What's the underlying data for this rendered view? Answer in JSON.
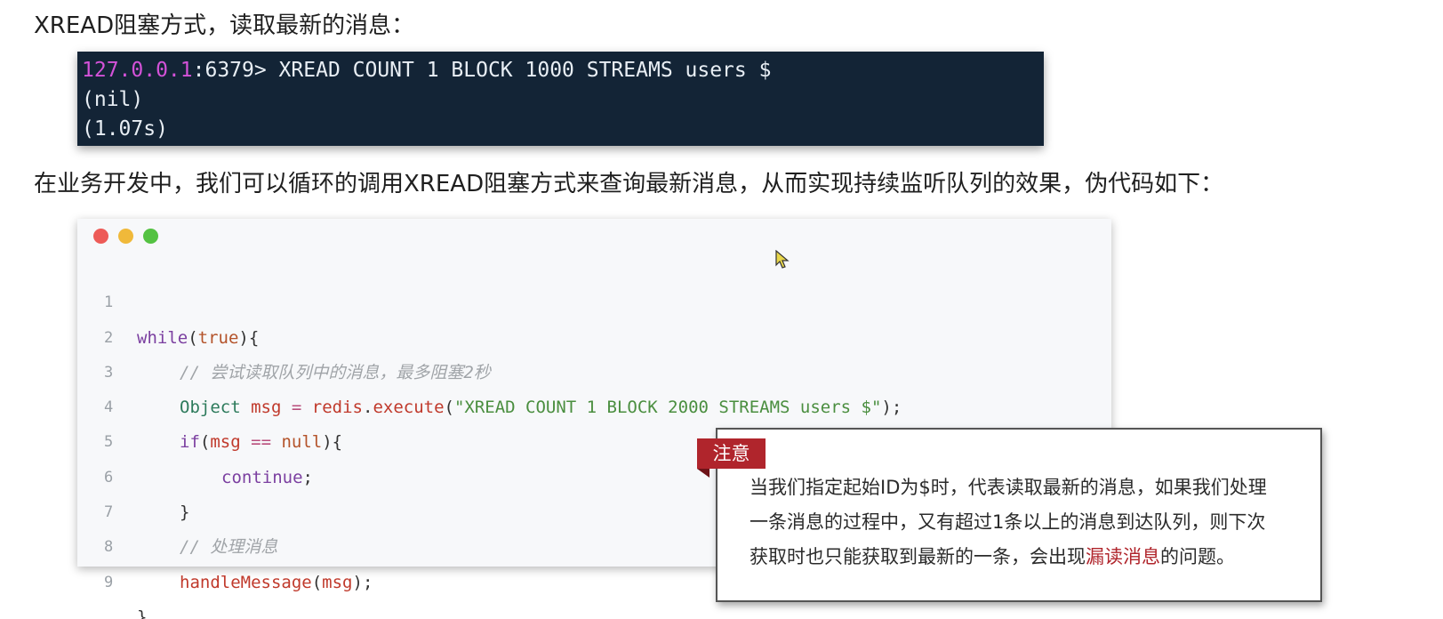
{
  "heading_1": "XREAD阻塞方式，读取最新的消息：",
  "terminal": {
    "host": "127.0.0.1",
    "command": ":6379> XREAD COUNT 1 BLOCK 1000 STREAMS users $",
    "output_1": "(nil)",
    "output_2": "(1.07s)"
  },
  "heading_2": "在业务开发中，我们可以循环的调用XREAD阻塞方式来查询最新消息，从而实现持续监听队列的效果，伪代码如下：",
  "code": {
    "line_numbers": [
      "1",
      "2",
      "3",
      "4",
      "5",
      "6",
      "7",
      "8",
      "9"
    ],
    "l1": {
      "kw": "while",
      "p1": "(",
      "lit": "true",
      "p2": "){"
    },
    "l2": {
      "comment": "// 尝试读取队列中的消息，最多阻塞2秒"
    },
    "l3": {
      "type": "Object",
      "var": "msg",
      "eq": "=",
      "obj": "redis",
      "dot": ".",
      "fn": "execute",
      "p1": "(",
      "str": "\"XREAD COUNT 1 BLOCK 2000 STREAMS users $\"",
      "p2": ");"
    },
    "l4": {
      "kw": "if",
      "p1": "(",
      "var": "msg",
      "op": "==",
      "lit": "null",
      "p2": "){"
    },
    "l5": {
      "kw": "continue",
      "p1": ";"
    },
    "l6": {
      "p1": "}"
    },
    "l7": {
      "comment": "// 处理消息"
    },
    "l8": {
      "fn": "handleMessage",
      "p1": "(",
      "var": "msg",
      "p2": ");"
    },
    "l9": {
      "p1": "}"
    }
  },
  "note": {
    "tag": "注意",
    "line_1": "当我们指定起始ID为$时，代表读取最新的消息，如果我们处理",
    "line_2": "一条消息的过程中，又有超过1条以上的消息到达队列，则下次",
    "line_3_pre": "获取时也只能获取到最新的一条，会出现",
    "line_3_hl": "漏读消息",
    "line_3_post": "的问题。"
  },
  "colors": {
    "note_accent": "#b0252c",
    "terminal_bg": "#132436",
    "prompt_host": "#d352d8"
  }
}
